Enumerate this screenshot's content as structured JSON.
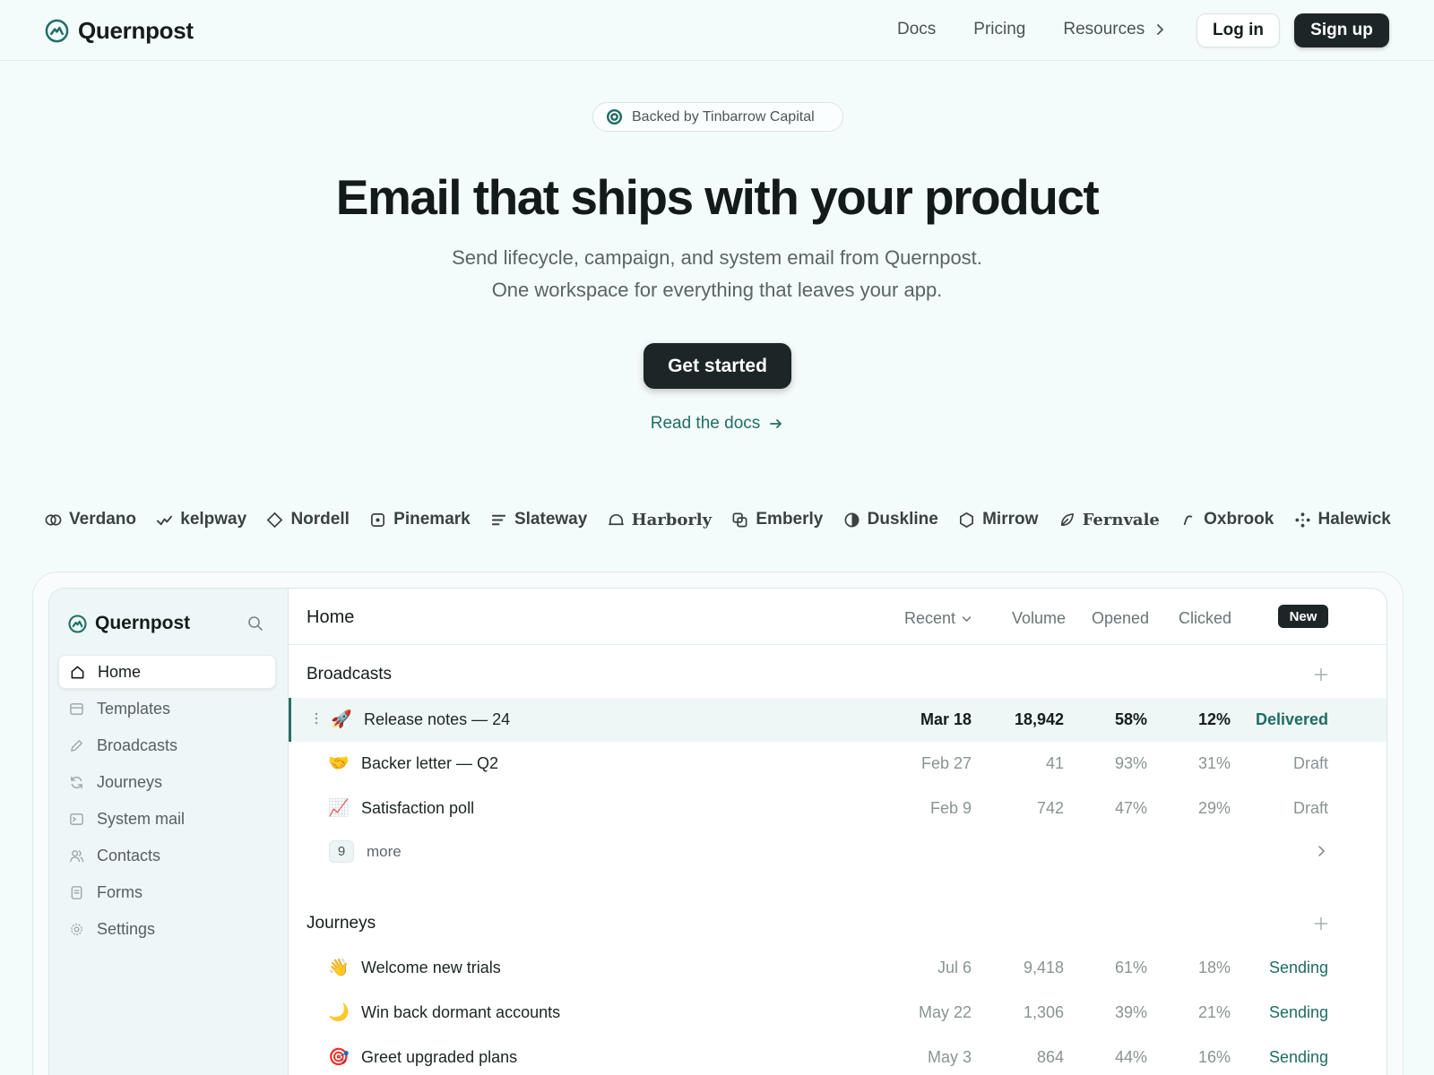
{
  "nav": {
    "brand": "Quernpost",
    "links": [
      "Docs",
      "Pricing",
      "Resources"
    ],
    "login": "Log in",
    "signup": "Sign up"
  },
  "hero": {
    "badge": "Backed by Tinbarrow Capital",
    "title": "Email that ships with your product",
    "subtitle_1": "Send lifecycle, campaign, and system email from Quernpost.",
    "subtitle_2": "One workspace for everything that leaves your app.",
    "cta": "Get started",
    "docs_link": "Read the docs"
  },
  "logos": [
    {
      "name": "Verdano",
      "icon": "rings-icon"
    },
    {
      "name": "kelpway",
      "icon": "wave-check-icon"
    },
    {
      "name": "Nordell",
      "icon": "diamond-icon"
    },
    {
      "name": "Pinemark",
      "icon": "square-dot-icon"
    },
    {
      "name": "Slateway",
      "icon": "lines-icon"
    },
    {
      "name": "Harborly",
      "icon": "arch-icon"
    },
    {
      "name": "Emberly",
      "icon": "layered-squares-icon"
    },
    {
      "name": "Duskline",
      "icon": "half-circle-icon"
    },
    {
      "name": "Mirrow",
      "icon": "hexagon-icon"
    },
    {
      "name": "Fernvale",
      "icon": "leaf-icon"
    },
    {
      "name": "Oxbrook",
      "icon": "hook-icon"
    },
    {
      "name": "Halewick",
      "icon": "dots-icon"
    }
  ],
  "app": {
    "brand": "Quernpost",
    "sidebar": [
      {
        "label": "Home",
        "icon": "home-icon",
        "active": true
      },
      {
        "label": "Templates",
        "icon": "templates-icon"
      },
      {
        "label": "Broadcasts",
        "icon": "pencil-icon"
      },
      {
        "label": "Journeys",
        "icon": "refresh-icon"
      },
      {
        "label": "System mail",
        "icon": "terminal-icon"
      },
      {
        "label": "Contacts",
        "icon": "users-icon"
      },
      {
        "label": "Forms",
        "icon": "form-icon"
      },
      {
        "label": "Settings",
        "icon": "gear-icon"
      }
    ],
    "header": {
      "title": "Home",
      "recent": "Recent",
      "volume": "Volume",
      "opened": "Opened",
      "clicked": "Clicked",
      "new": "New"
    },
    "broadcasts": {
      "title": "Broadcasts",
      "rows": [
        {
          "emoji": "🚀",
          "name": "Release notes — 24",
          "date": "Mar 18",
          "volume": "18,942",
          "opened": "58%",
          "clicked": "12%",
          "status": "Delivered"
        },
        {
          "emoji": "🤝",
          "name": "Backer letter — Q2",
          "date": "Feb 27",
          "volume": "41",
          "opened": "93%",
          "clicked": "31%",
          "status": "Draft"
        },
        {
          "emoji": "📈",
          "name": "Satisfaction poll",
          "date": "Feb 9",
          "volume": "742",
          "opened": "47%",
          "clicked": "29%",
          "status": "Draft"
        }
      ],
      "more_count": "9",
      "more_label": "more"
    },
    "journeys": {
      "title": "Journeys",
      "rows": [
        {
          "emoji": "👋",
          "name": "Welcome new trials",
          "date": "Jul 6",
          "volume": "9,418",
          "opened": "61%",
          "clicked": "18%",
          "status": "Sending"
        },
        {
          "emoji": "🌙",
          "name": "Win back dormant accounts",
          "date": "May 22",
          "volume": "1,306",
          "opened": "39%",
          "clicked": "21%",
          "status": "Sending"
        },
        {
          "emoji": "🎯",
          "name": "Greet upgraded plans",
          "date": "May 3",
          "volume": "864",
          "opened": "44%",
          "clicked": "16%",
          "status": "Sending"
        }
      ]
    }
  },
  "colors": {
    "accent": "#1e6c62",
    "dark": "#1d2627",
    "background": "#f4fbfb"
  }
}
